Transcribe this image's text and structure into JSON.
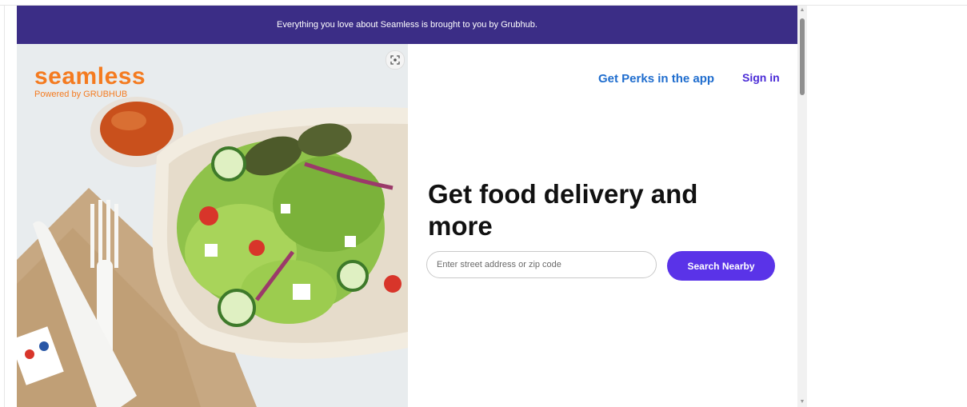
{
  "banner": {
    "text": "Everything you love about Seamless is brought to you by Grubhub."
  },
  "logo": {
    "wordmark": "seamless",
    "tagline": "Powered by GRUBHUB"
  },
  "hero": {
    "image_icon": "expand-icon"
  },
  "header": {
    "perks_label": "Get Perks in the app",
    "signin_label": "Sign in"
  },
  "main": {
    "headline": "Get food delivery and more",
    "address_placeholder": "Enter street address or zip code",
    "address_value": "",
    "search_label": "Search Nearby"
  },
  "colors": {
    "banner_bg": "#3b2d86",
    "brand_orange": "#f47b20",
    "link_blue": "#1f6dce",
    "signin_purple": "#4a2bd6",
    "button_purple": "#5a33e8"
  },
  "icons": {
    "scroll_up": "▲",
    "scroll_down": "▼"
  }
}
